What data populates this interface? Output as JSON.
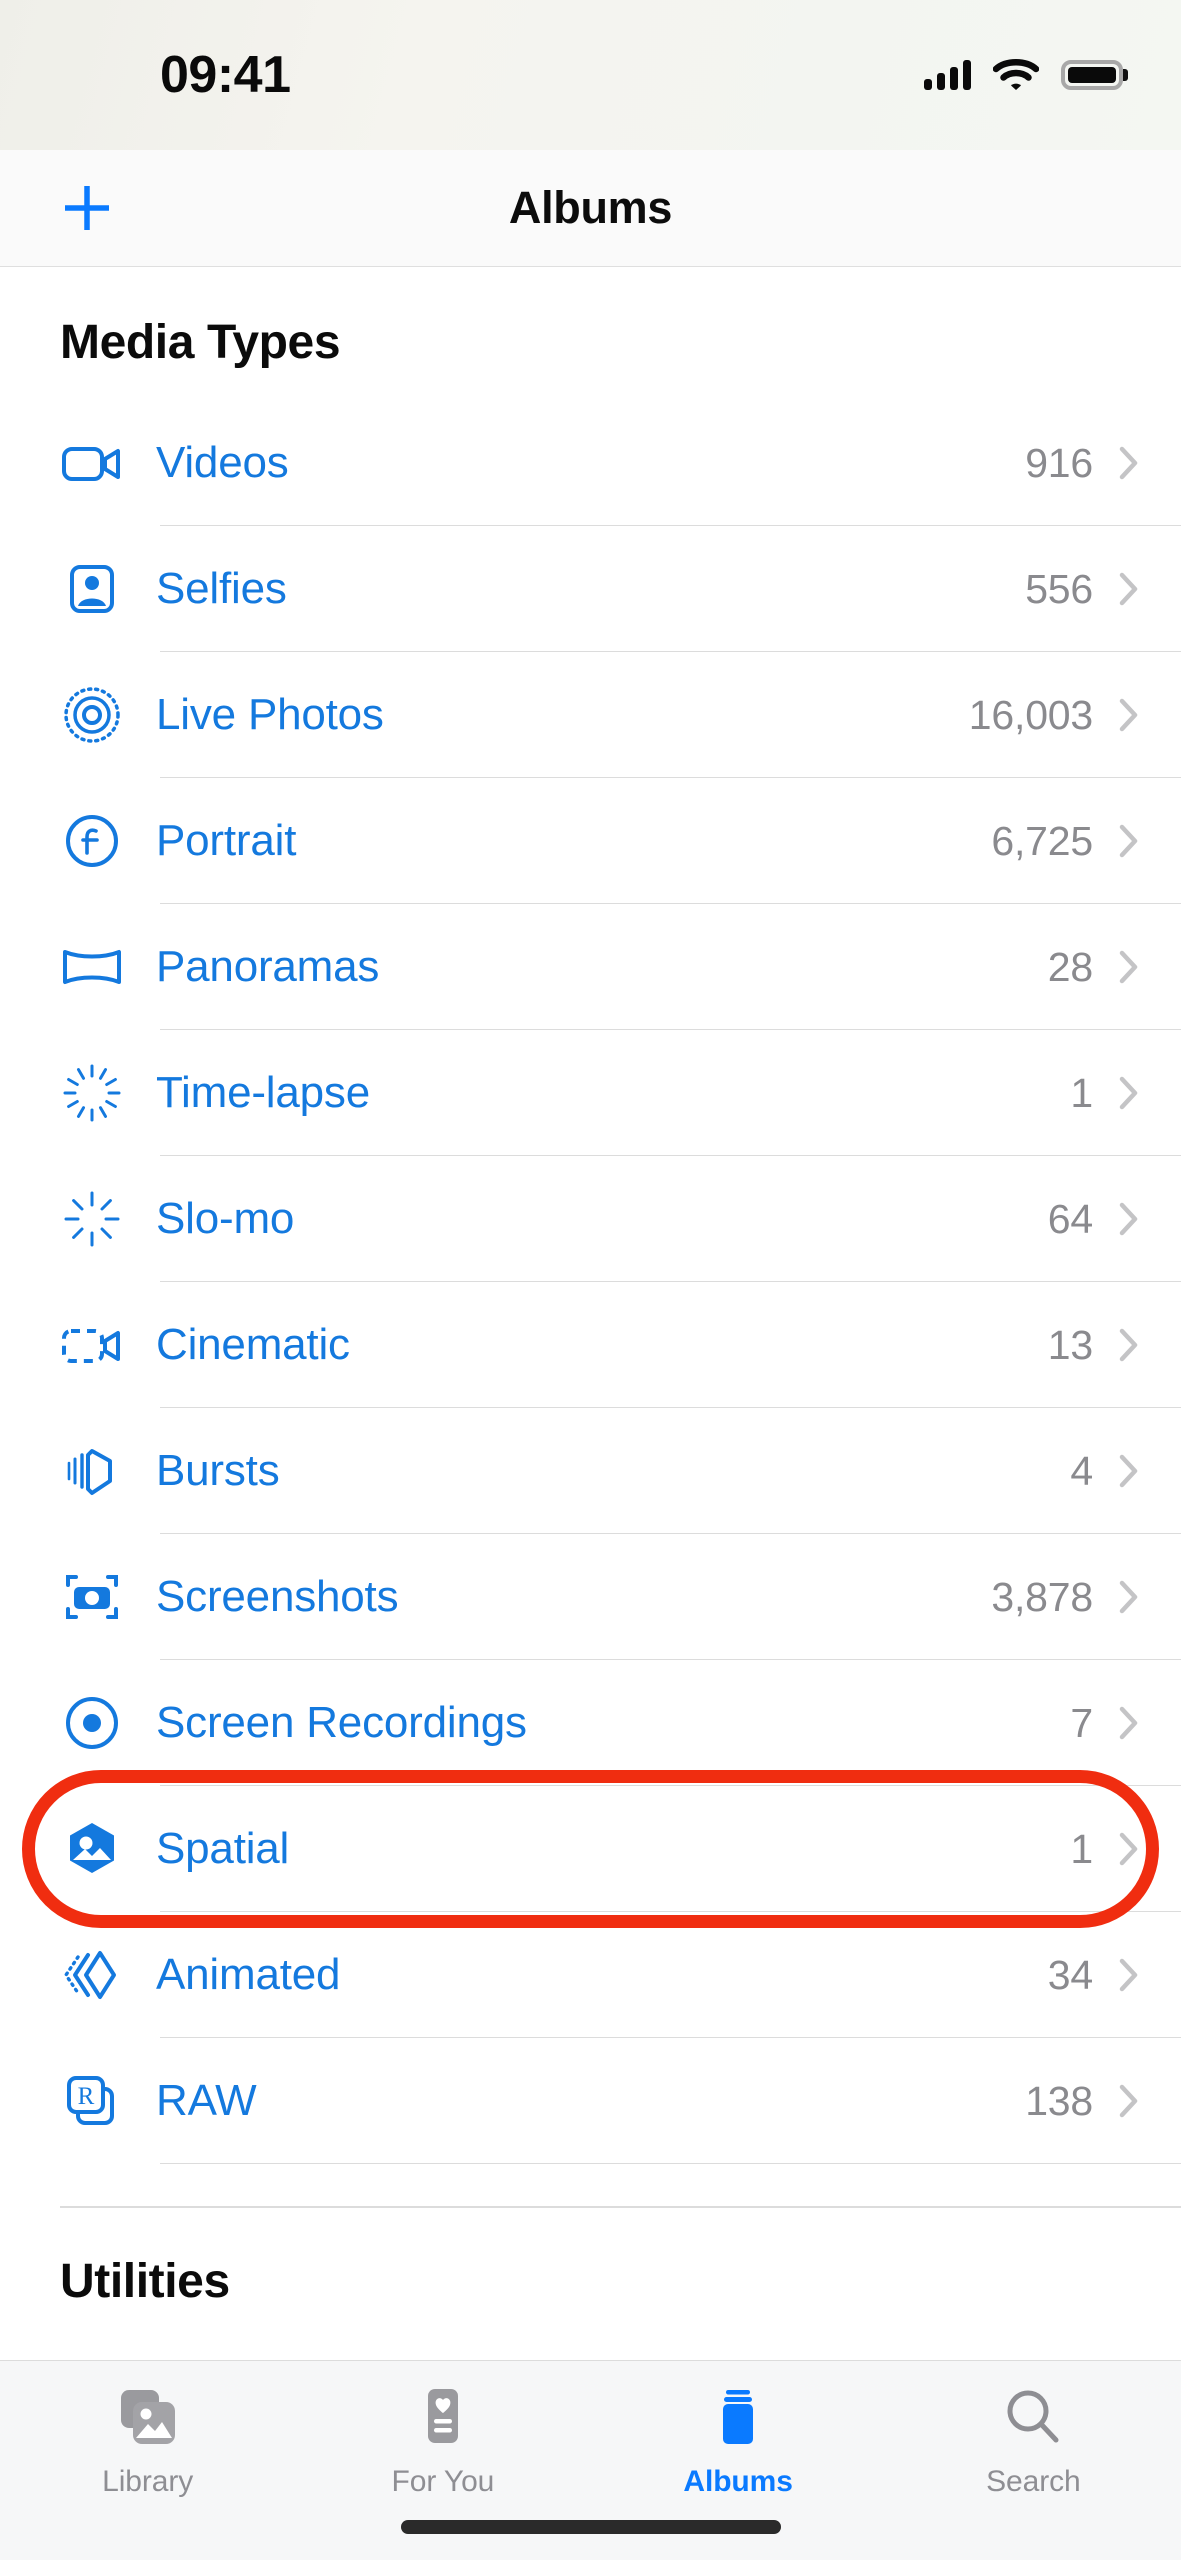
{
  "status_bar": {
    "time": "09:41",
    "icons": [
      "cellular-signal-icon",
      "wifi-icon",
      "battery-icon"
    ]
  },
  "nav_bar": {
    "add_icon": "plus-icon",
    "title": "Albums"
  },
  "sections": [
    {
      "header": "Media Types",
      "rows": [
        {
          "icon": "video-camera-icon",
          "label": "Videos",
          "count": "916"
        },
        {
          "icon": "selfie-person-icon",
          "label": "Selfies",
          "count": "556"
        },
        {
          "icon": "live-photo-icon",
          "label": "Live Photos",
          "count": "16,003"
        },
        {
          "icon": "portrait-aperture-icon",
          "label": "Portrait",
          "count": "6,725"
        },
        {
          "icon": "panorama-icon",
          "label": "Panoramas",
          "count": "28"
        },
        {
          "icon": "timelapse-icon",
          "label": "Time-lapse",
          "count": "1"
        },
        {
          "icon": "slomo-icon",
          "label": "Slo-mo",
          "count": "64"
        },
        {
          "icon": "cinematic-video-icon",
          "label": "Cinematic",
          "count": "13"
        },
        {
          "icon": "bursts-stack-icon",
          "label": "Bursts",
          "count": "4"
        },
        {
          "icon": "screenshot-camera-icon",
          "label": "Screenshots",
          "count": "3,878"
        },
        {
          "icon": "screen-recording-icon",
          "label": "Screen Recordings",
          "count": "7"
        },
        {
          "icon": "spatial-hexagon-icon",
          "label": "Spatial",
          "count": "1"
        },
        {
          "icon": "animated-diamond-icon",
          "label": "Animated",
          "count": "34"
        },
        {
          "icon": "raw-file-icon",
          "label": "RAW",
          "count": "138"
        }
      ]
    },
    {
      "header": "Utilities",
      "rows": []
    }
  ],
  "highlight": {
    "target_label": "Spatial",
    "color": "#f02d10"
  },
  "tab_bar": {
    "tabs": [
      {
        "icon": "photo-library-icon",
        "label": "Library",
        "active": false
      },
      {
        "icon": "for-you-card-icon",
        "label": "For You",
        "active": false
      },
      {
        "icon": "albums-book-icon",
        "label": "Albums",
        "active": true
      },
      {
        "icon": "magnifier-icon",
        "label": "Search",
        "active": false
      }
    ]
  },
  "colors": {
    "accent_blue": "#1479de",
    "tab_active_blue": "#0a7aff",
    "count_gray": "#8a8a8e",
    "highlight_red": "#f02d10"
  }
}
